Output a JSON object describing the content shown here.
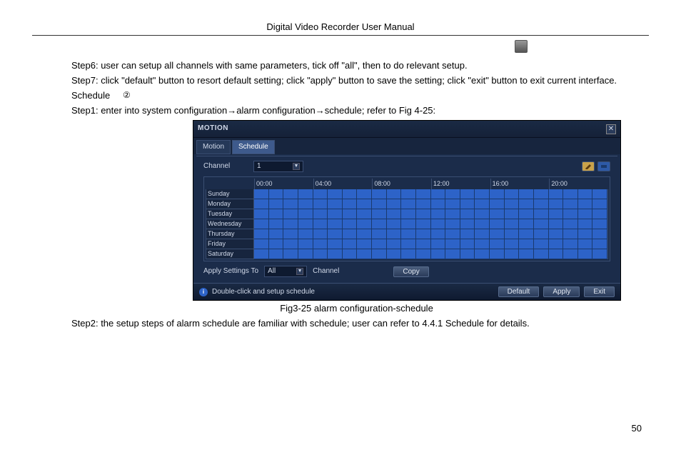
{
  "header": {
    "title": "Digital Video Recorder User Manual"
  },
  "icons": {
    "trash": "trash-icon"
  },
  "steps": {
    "step6": "Step6: user can setup all channels with same parameters, tick off \"all\", then to do relevant setup.",
    "step7": "Step7: click \"default\" button to resort default setting; click \"apply\" button to save the setting; click \"exit\" button to exit current interface.",
    "section_marker": "②",
    "section_title": "Schedule",
    "step1": "Step1: enter into system configuration→alarm configuration→schedule; refer to Fig 4-25:",
    "caption": "Fig3-25 alarm configuration-schedule",
    "step2": "Step2: the setup steps of alarm schedule are familiar with schedule; user can refer to 4.4.1 Schedule for details."
  },
  "motion": {
    "title": "MOTION",
    "tabs": [
      "Motion",
      "Schedule"
    ],
    "active_tab": 1,
    "channel_label": "Channel",
    "channel_value": "1",
    "time_headers": [
      "00:00",
      "04:00",
      "08:00",
      "12:00",
      "16:00",
      "20:00"
    ],
    "days": [
      "Sunday",
      "Monday",
      "Tuesday",
      "Wednesday",
      "Thursday",
      "Friday",
      "Saturday"
    ],
    "apply_label": "Apply Settings To",
    "apply_value": "All",
    "channel_word": "Channel",
    "copy_btn": "Copy",
    "hint": "Double-click and setup schedule",
    "footer_btns": [
      "Default",
      "Apply",
      "Exit"
    ]
  },
  "page_number": "50"
}
